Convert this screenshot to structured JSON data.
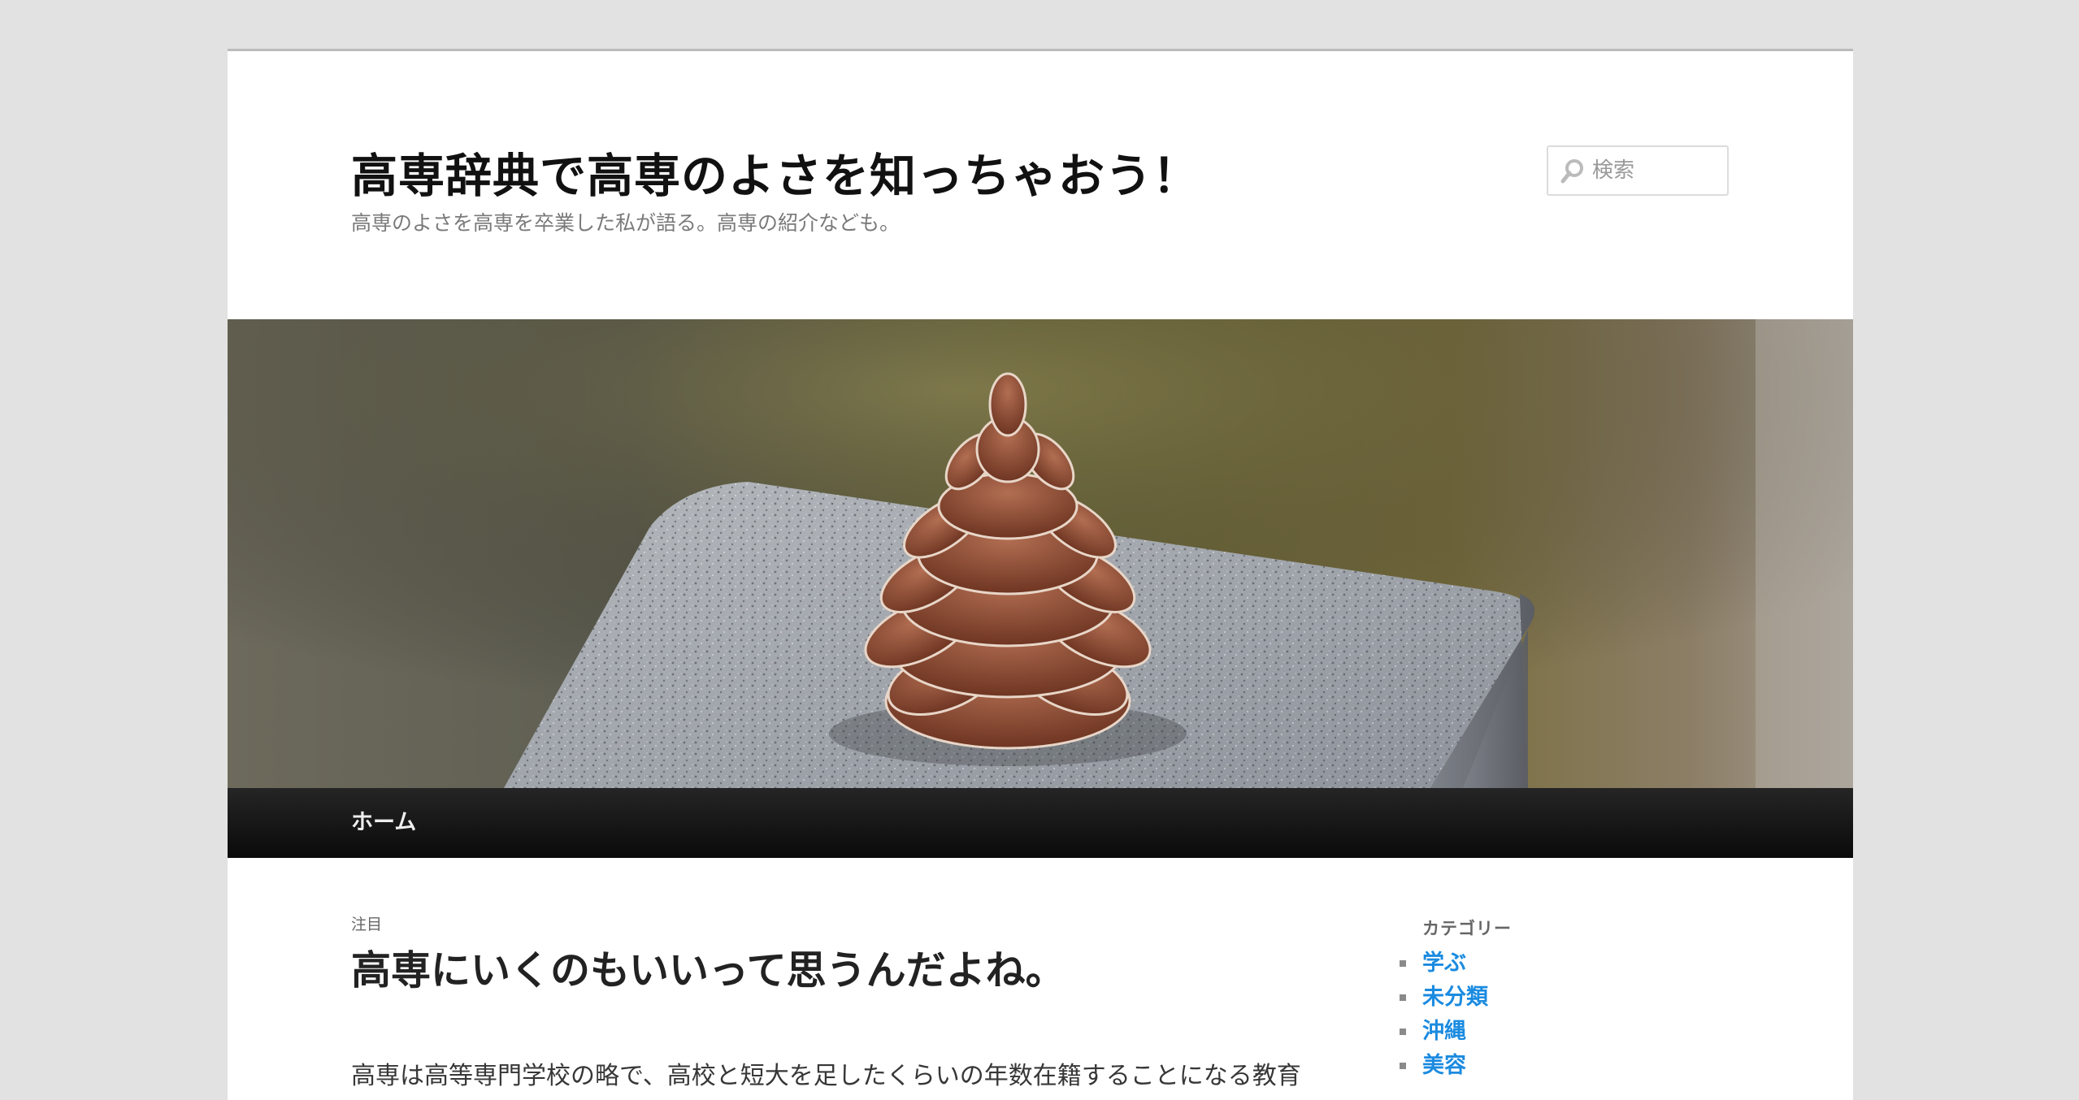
{
  "site": {
    "title": "高専辞典で高専のよさを知っちゃおう！",
    "description": "高専のよさを高専を卒業した私が語る。高専の紹介なども。"
  },
  "search": {
    "placeholder": "検索",
    "icon": "search-icon"
  },
  "header_image": {
    "subject": "pine-cone-on-granite"
  },
  "nav": {
    "items": [
      {
        "label": "ホーム"
      }
    ]
  },
  "featured_post": {
    "label": "注目",
    "title": "高専にいくのもいいって思うんだよね。",
    "excerpt": "高専は高等専門学校の略で、高校と短大を足したくらいの年数在籍することになる教育機関"
  },
  "sidebar": {
    "categories_title": "カテゴリー",
    "categories": [
      {
        "label": "学ぶ"
      },
      {
        "label": "未分類"
      },
      {
        "label": "沖縄"
      },
      {
        "label": "美容"
      }
    ]
  },
  "colors": {
    "link": "#1b8be0",
    "nav_bg": "#111111",
    "page_bg": "#e2e2e2"
  }
}
